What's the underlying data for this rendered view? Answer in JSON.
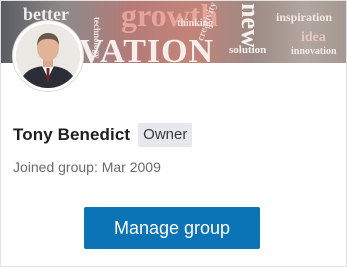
{
  "banner": {
    "words": [
      "better",
      "growth",
      "new",
      "VATION",
      "creativity",
      "inspiration",
      "idea",
      "solution",
      "technology",
      "innovation",
      "thinking"
    ]
  },
  "profile": {
    "name": "Tony Benedict",
    "role_badge": "Owner",
    "joined": "Joined group: Mar 2009"
  },
  "actions": {
    "manage_label": "Manage group"
  },
  "colors": {
    "button": "#0b74b6",
    "badge_bg": "#e5e8ec"
  }
}
